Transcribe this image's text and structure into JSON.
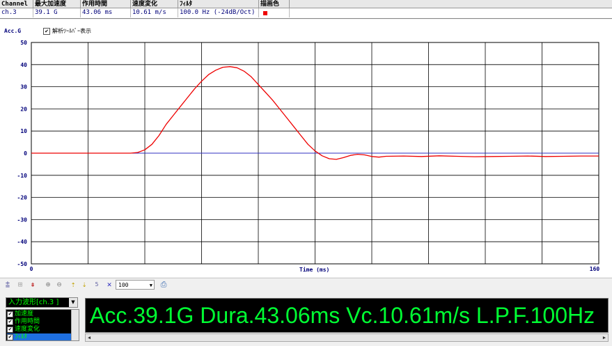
{
  "info_table": {
    "headers": [
      "Channel",
      "最大加速度",
      "作用時間",
      "速度変化",
      "ﾌｨﾙﾀ",
      "描画色"
    ],
    "values": [
      "ch.3",
      "39.1 G",
      "43.06 ms",
      "10.61 m/s",
      "100.0 Hz (-24dB/Oct)",
      ""
    ],
    "draw_color": "#ee0000"
  },
  "chart": {
    "y_axis_label": "Acc.G",
    "toolbar_toggle_label": "解析ﾂｰﾙﾊﾞｰ表示",
    "toolbar_toggle_checked": true
  },
  "chart_data": {
    "type": "line",
    "xlabel": "Time (ms)",
    "ylabel": "Acc.G",
    "xlim": [
      0,
      160
    ],
    "ylim": [
      -50,
      50
    ],
    "x_tick_labels": [
      "0",
      "160"
    ],
    "y_tick_labels": [
      "50",
      "40",
      "30",
      "20",
      "10",
      "0",
      "-10",
      "-20",
      "-30",
      "-40",
      "-50"
    ],
    "grid": true,
    "series": [
      {
        "color": "#ee0000",
        "x": [
          0,
          28,
          30,
          32,
          34,
          36,
          38,
          40,
          42,
          44,
          46,
          48,
          50,
          52,
          54,
          56,
          58,
          60,
          62,
          64,
          66,
          68,
          70,
          72,
          74,
          76,
          78,
          80,
          82,
          84,
          86,
          88,
          90,
          92,
          94,
          96,
          98,
          100,
          105,
          110,
          115,
          120,
          125,
          130,
          135,
          140,
          145,
          150,
          155,
          160
        ],
        "values": [
          0,
          0,
          0.3,
          1.5,
          4,
          8,
          13,
          17,
          21,
          25,
          29,
          32.5,
          35.5,
          37.5,
          38.8,
          39.1,
          38.6,
          37,
          34.5,
          31,
          27.5,
          24,
          20,
          16,
          12,
          8,
          4,
          1,
          -1.2,
          -2.5,
          -2.8,
          -2,
          -1,
          -0.5,
          -0.8,
          -1.5,
          -1.8,
          -1.4,
          -1.3,
          -1.5,
          -1.2,
          -1.4,
          -1.6,
          -1.5,
          -1.4,
          -1.3,
          -1.5,
          -1.4,
          -1.3,
          -1.3
        ]
      },
      {
        "color": "#3030c0",
        "x": [
          0,
          160
        ],
        "values": [
          0,
          0
        ]
      }
    ]
  },
  "toolbar": {
    "zoom_value": "100",
    "icons": [
      "fit-icon",
      "grid-icon",
      "cursor-icon",
      "zoom-in-icon",
      "zoom-out-icon",
      "shift-up-icon",
      "shift-down-icon",
      "step-icon",
      "cross-icon",
      "print-icon"
    ],
    "step_label": "5"
  },
  "bottom": {
    "wave_select_label": "入力波形[ch.3 ]",
    "checklist": [
      {
        "label": "加速度",
        "checked": true
      },
      {
        "label": "作用時間",
        "checked": true
      },
      {
        "label": "速度変化",
        "checked": true
      },
      {
        "label": "ﾌｨﾙﾀ",
        "checked": true
      }
    ],
    "led_text": "Acc.39.1G Dura.43.06ms Vc.10.61m/s L.P.F.100Hz"
  }
}
